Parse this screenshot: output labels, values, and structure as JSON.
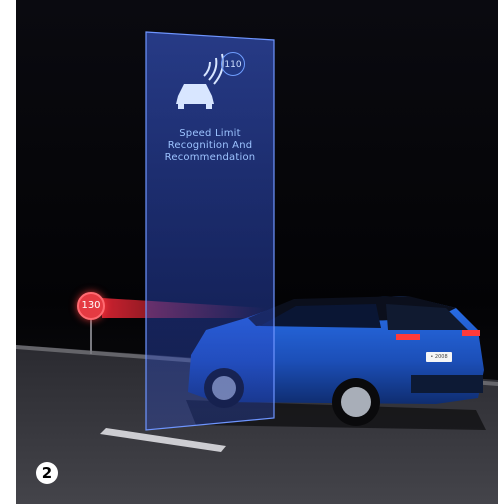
{
  "scene": {
    "alt": "Blue Peugeot SUV driving at night on a road, passing a 130 speed limit sign, with a holographic panel showing the driver assistance feature",
    "colors": {
      "background": "#000000",
      "panel": "#3c5fe0",
      "car": "#1f5fd6",
      "sign": "#e53a42",
      "road": "#3c3c42"
    }
  },
  "panel": {
    "icon": "car-signal-icon",
    "speed_badge": "110",
    "title_line1": "Speed Limit",
    "title_line2": "Recognition And",
    "title_line3": "Recommendation"
  },
  "road_sign": {
    "speed": "130"
  },
  "car": {
    "plate": "• 2008"
  },
  "step_number": "2"
}
